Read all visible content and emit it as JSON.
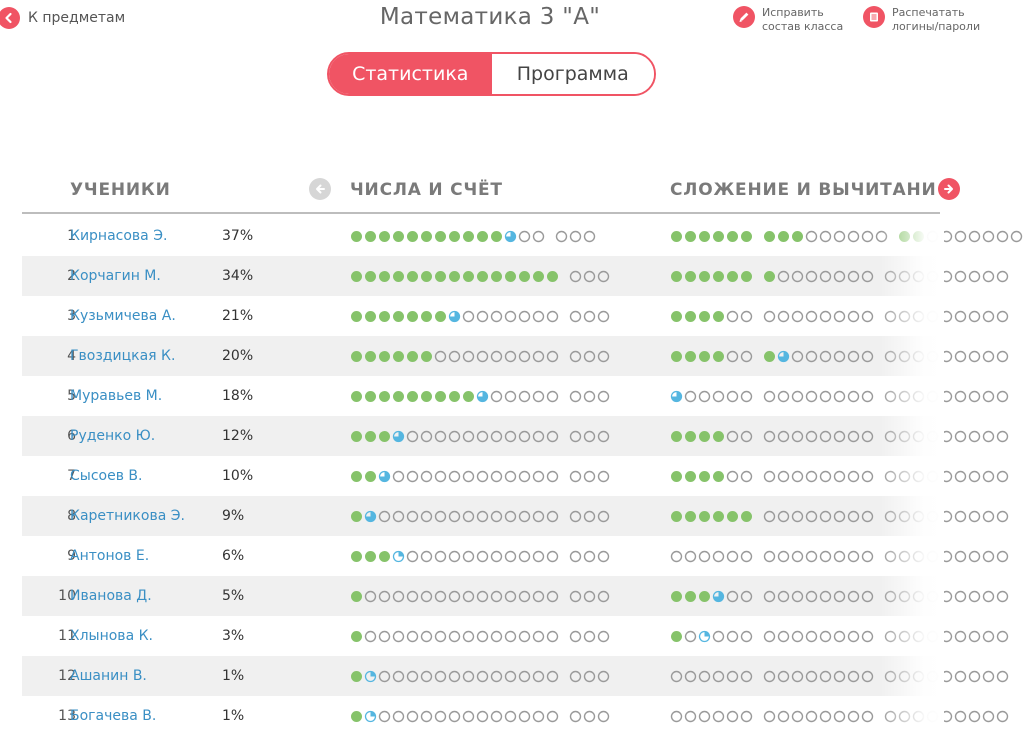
{
  "header": {
    "back_label": "К предметам",
    "title": "Математика 3 \"А\"",
    "edit_label_1": "Исправить",
    "edit_label_2": "состав класса",
    "print_label_1": "Распечатать",
    "print_label_2": "логины/пароли"
  },
  "tabs": [
    {
      "label": "Статистика",
      "active": true
    },
    {
      "label": "Программа",
      "active": false
    }
  ],
  "table": {
    "col_students": "УЧЕНИКИ",
    "categories": [
      "ЧИСЛА И СЧЁТ",
      "СЛОЖЕНИЕ И ВЫЧИТАНИЕ"
    ],
    "colors": {
      "done": "#86c36a",
      "partial": "#55b6e0",
      "empty": "#9a9a9a",
      "accent": "#f05464"
    }
  },
  "students": [
    {
      "num": "1",
      "name": "Кирнасова Э.",
      "pct": "37%",
      "c1": "fffffffffffhee eee",
      "c2": "ffffff fffeeeeee ffeeeeeee"
    },
    {
      "num": "2",
      "name": "Корчагин М.",
      "pct": "34%",
      "c1": "fffffffffffffff eee",
      "c2": "ffffff feeeeeee eeeeeeeee"
    },
    {
      "num": "3",
      "name": "Кузьмичева А.",
      "pct": "21%",
      "c1": "fffffffheeeeeee eee",
      "c2": "ffffee eeeeeeee eeeeeeeee"
    },
    {
      "num": "4",
      "name": "Гвоздицкая К.",
      "pct": "20%",
      "c1": "ffffffeeeeeeeee eee",
      "c2": "ffffee fheeeeee eeeeeeeee"
    },
    {
      "num": "5",
      "name": "Муравьев М.",
      "pct": "18%",
      "c1": "fffffffffheeeee eee",
      "c2": "heeeee eeeeeeee eeeeeeeee"
    },
    {
      "num": "6",
      "name": "Руденко Ю.",
      "pct": "12%",
      "c1": "fffheeeeeeeeeee eee",
      "c2": "ffffee eeeeeeee eeeeeeeee"
    },
    {
      "num": "7",
      "name": "Сысоев В.",
      "pct": "10%",
      "c1": "ffheeeeeeeeeeee eee",
      "c2": "ffffee eeeeeeee eeeeeeeee"
    },
    {
      "num": "8",
      "name": "Каретникова Э.",
      "pct": "9%",
      "c1": "fheeeeeeeeeeeee eee",
      "c2": "ffffff eeeeeeee eeeeeeeee"
    },
    {
      "num": "9",
      "name": "Антонов Е.",
      "pct": "6%",
      "c1": "fffqeeeeeeeeeee eee",
      "c2": "eeeeee eeeeeeee eeeeeeeee"
    },
    {
      "num": "10",
      "name": "Иванова Д.",
      "pct": "5%",
      "c1": "feeeeeeeeeeeeee eee",
      "c2": "fffhee eeeeeeee eeeeeeeee"
    },
    {
      "num": "11",
      "name": "Хлынова К.",
      "pct": "3%",
      "c1": "feeeeeeeeeeeeee eee",
      "c2": "feqeee eeeeeeee eeeeeeeee"
    },
    {
      "num": "12",
      "name": "Ашанин В.",
      "pct": "1%",
      "c1": "fqeeeeeeeeeeeee eee",
      "c2": "eeeeee eeeeeeee eeeeeeeee"
    },
    {
      "num": "13",
      "name": "Богачева В.",
      "pct": "1%",
      "c1": "fqeeeeeeeeeeeee eee",
      "c2": "eeeeee eeeeeeee eeeeeeeee"
    }
  ]
}
